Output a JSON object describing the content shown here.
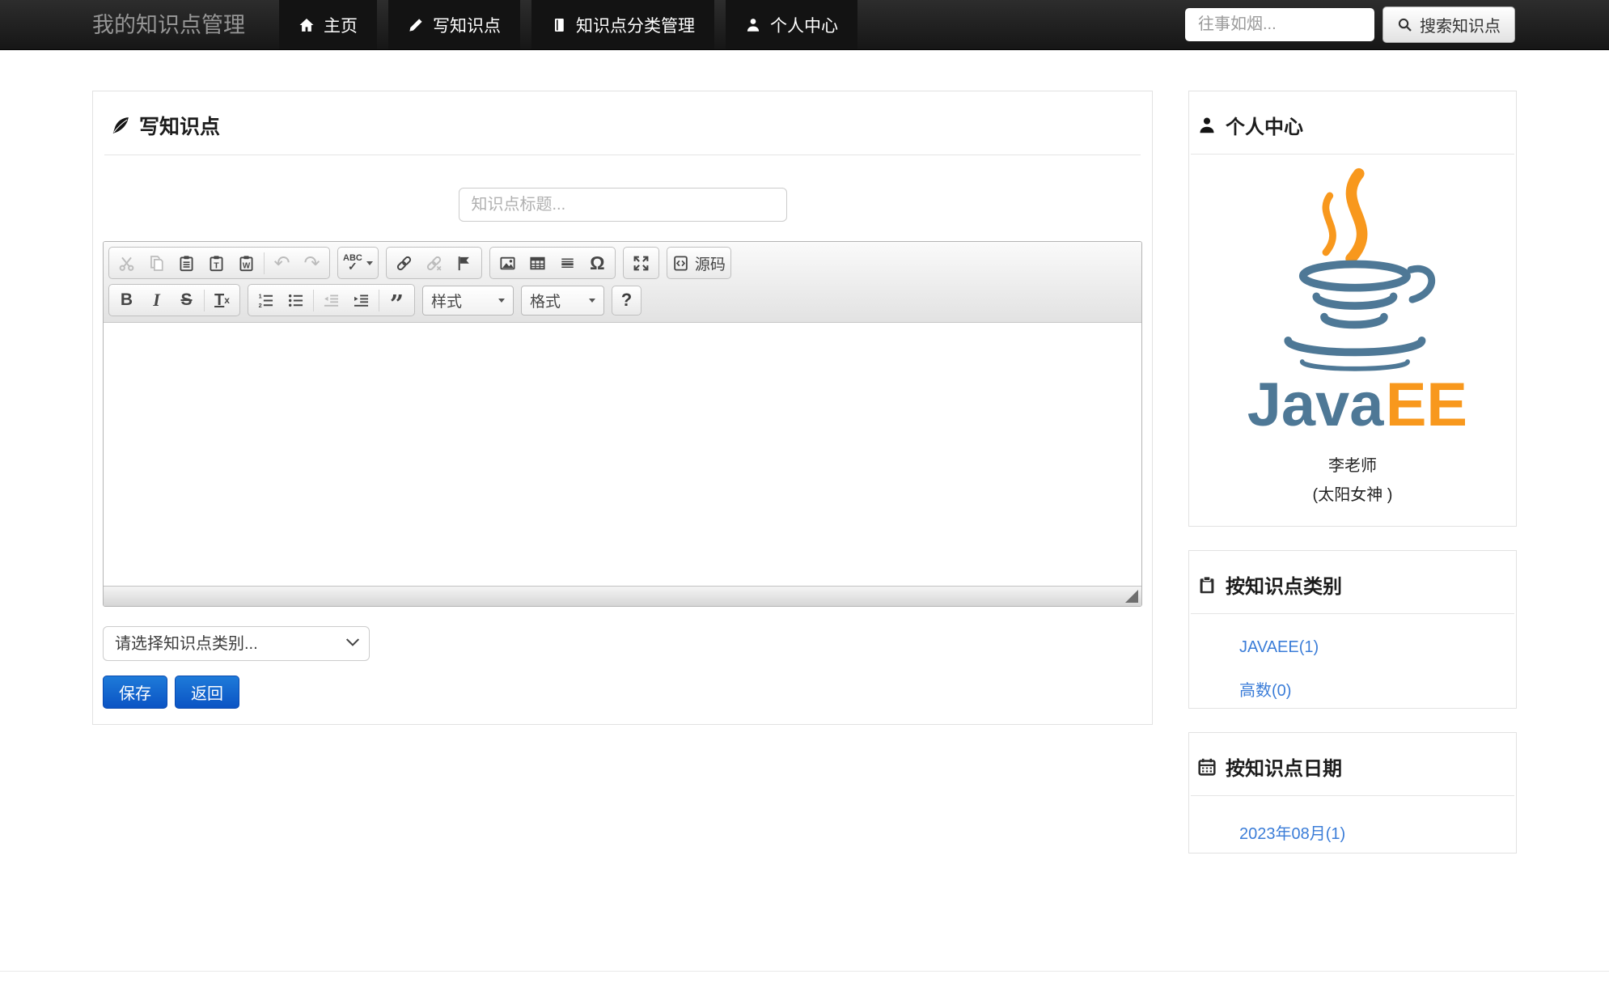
{
  "navbar": {
    "brand": "我的知识点管理",
    "items": [
      {
        "label": "主页",
        "icon": "home-icon"
      },
      {
        "label": "写知识点",
        "icon": "pencil-icon"
      },
      {
        "label": "知识点分类管理",
        "icon": "book-icon"
      },
      {
        "label": "个人中心",
        "icon": "user-icon"
      }
    ],
    "search": {
      "placeholder": "往事如烟...",
      "button_label": "搜索知识点",
      "icon": "search-icon"
    }
  },
  "editor_panel": {
    "title": "写知识点",
    "title_icon": "quill-icon",
    "title_input_placeholder": "知识点标题...",
    "toolbar": {
      "row1_icons": [
        "cut",
        "copy",
        "paste",
        "paste-plain-text",
        "paste-from-word",
        "undo",
        "redo",
        "spell-check",
        "link",
        "unlink",
        "anchor-flag",
        "image",
        "table",
        "horizontal-line",
        "special-character",
        "maximize",
        "source"
      ],
      "row2_icons": [
        "bold",
        "italic",
        "strikethrough",
        "remove-format",
        "numbered-list",
        "bulleted-list",
        "outdent",
        "indent",
        "block-quote",
        "styles-dropdown",
        "format-dropdown",
        "help"
      ],
      "spell_abc": "ABC",
      "spell_check": "✓",
      "undo_glyph": "↶",
      "redo_glyph": "↷",
      "omega_label": "Ω",
      "bold_label": "B",
      "italic_label": "I",
      "strike_label": "S",
      "removeformat_t": "T",
      "removeformat_x": "x",
      "quote_label": "”",
      "source_label": "源码",
      "styles_dropdown_label": "样式",
      "format_dropdown_label": "格式",
      "help_label": "?"
    },
    "editor_content": "",
    "category_select_value": "请选择知识点类别...",
    "save_button": "保存",
    "back_button": "返回"
  },
  "sidebar": {
    "profile": {
      "title": "个人中心",
      "icon": "user-icon",
      "logo": {
        "java_text": "Java",
        "ee_text": "EE"
      },
      "name": "李老师",
      "nickname": "(太阳女神 )"
    },
    "categories": {
      "title": "按知识点类别",
      "icon": "clipboard-icon",
      "links": [
        {
          "label": "JAVAEE(1)"
        },
        {
          "label": "高数(0)"
        }
      ]
    },
    "archive": {
      "title": "按知识点日期",
      "icon": "calendar-icon",
      "links": [
        {
          "label": "2023年08月(1)"
        }
      ]
    }
  },
  "colors": {
    "navbar_bg": "#1d1d1d",
    "primary_button_blue": "#1273d4",
    "link_blue": "#3b7dd8",
    "java_logo_blue": "#4e7896",
    "java_logo_orange": "#f8981d"
  }
}
